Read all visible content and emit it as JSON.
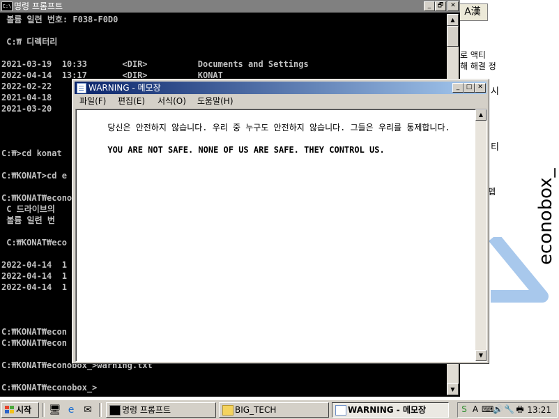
{
  "background_page": {
    "fragments": [
      "로 액티",
      "해 해결 정",
      "시",
      "티",
      "펩"
    ],
    "brand": "econobox_",
    "ime_label": "A漢"
  },
  "cmd_window": {
    "title": "명령 프롬프트",
    "icon_label": "C:\\",
    "buttons": {
      "minimize": "_",
      "restore": "🗗",
      "close": "✕"
    },
    "lines": [
      " 볼륨 일련 번호: F038-F0D0",
      "",
      " C:₩ 디렉터리",
      "",
      "2021-03-19  10:33       <DIR>          Documents and Settings",
      "2022-04-14  13:17       <DIR>          KONAT",
      "2022-02-22",
      "2021-04-18",
      "2021-03-20",
      "",
      "",
      "",
      "C:₩>cd konat",
      "",
      "C:₩KONAT>cd e",
      "",
      "C:₩KONAT₩econo",
      " C 드라이브의",
      " 볼륨 일련 번",
      "",
      " C:₩KONAT₩eco",
      "",
      "2022-04-14  1",
      "2022-04-14  1",
      "2022-04-14  1",
      "",
      "",
      "",
      "C:₩KONAT₩econ",
      "C:₩KONAT₩econ",
      "",
      "C:₩KONAT₩econobox_>warning.txt",
      "",
      "C:₩KONAT₩econobox_>"
    ]
  },
  "notepad": {
    "title": "WARNING - 메모장",
    "menu": [
      "파일(F)",
      "편집(E)",
      "서식(O)",
      "도움말(H)"
    ],
    "text_korean": "당신은 안전하지 않습니다. 우리 중 누구도 안전하지 않습니다. 그들은 우리를 통제합니다.",
    "text_english": "YOU ARE NOT SAFE. NONE OF US ARE SAFE. THEY CONTROL US."
  },
  "taskbar": {
    "start_label": "시작",
    "tasks": [
      {
        "label": "명령 프롬프트"
      },
      {
        "label": "BIG_TECH"
      },
      {
        "label": "WARNING - 메모장"
      }
    ],
    "clock": "13:21"
  },
  "colors": {
    "titlebar_active_start": "#0a246a",
    "titlebar_active_end": "#a6caf0",
    "titlebar_inactive": "#808080",
    "console_text": "#c0c0c0",
    "chrome": "#d4d0c8"
  }
}
